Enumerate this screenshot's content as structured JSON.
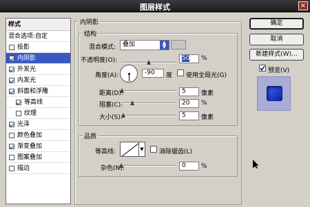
{
  "window": {
    "title": "图层样式",
    "close_glyph": "×"
  },
  "sidebar": {
    "header": "样式",
    "items": [
      {
        "label": "混合选项:自定"
      },
      {
        "label": "投影",
        "checked": false
      },
      {
        "label": "内阴影",
        "checked": true,
        "selected": true
      },
      {
        "label": "外发光",
        "checked": true
      },
      {
        "label": "内发光",
        "checked": true
      },
      {
        "label": "斜面和浮雕",
        "checked": true
      },
      {
        "label": "等高线",
        "checked": true
      },
      {
        "label": "纹理",
        "checked": false
      },
      {
        "label": "光泽",
        "checked": true
      },
      {
        "label": "颜色叠加",
        "checked": false
      },
      {
        "label": "渐变叠加",
        "checked": true
      },
      {
        "label": "图案叠加",
        "checked": false
      },
      {
        "label": "描边",
        "checked": false
      }
    ]
  },
  "panel": {
    "section_title": "内阴影",
    "structure": {
      "title": "结构",
      "blend_mode_label": "混合模式:",
      "blend_mode_value": "叠加",
      "opacity_label": "不透明度(O):",
      "opacity_value": "50",
      "opacity_percent": 50,
      "opacity_unit": "%",
      "angle_label": "角度(A):",
      "angle_value": "-90",
      "angle_unit": "度",
      "global_light_label": "使用全局光(G)",
      "global_light_checked": false,
      "distance_label": "距离(D):",
      "distance_value": "5",
      "distance_unit": "像素",
      "choke_label": "阻塞(C):",
      "choke_value": "20",
      "choke_unit": "%",
      "size_label": "大小(S):",
      "size_value": "5",
      "size_unit": "像素"
    },
    "quality": {
      "title": "品质",
      "contour_label": "等高线:",
      "antialias_label": "消除锯齿(L)",
      "antialias_checked": false,
      "noise_label": "杂色(N):",
      "noise_value": "0",
      "noise_unit": "%"
    }
  },
  "buttons": {
    "ok": "确定",
    "cancel": "取消",
    "new_style": "新建样式(W)...",
    "preview_label": "预览(V)",
    "preview_checked": true
  },
  "colors": {
    "selection": "#3958c4",
    "preview_bg": "#a9acd6",
    "preview_square": "#1f3fd8"
  }
}
